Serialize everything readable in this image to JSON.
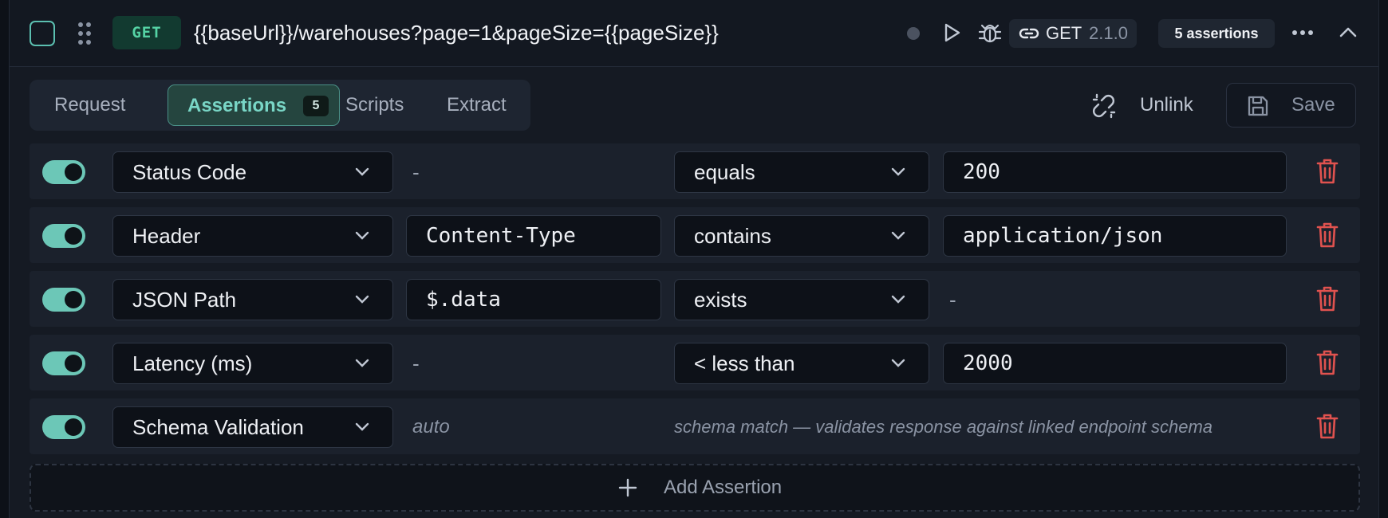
{
  "header": {
    "method": "GET",
    "url": "{{baseUrl}}/warehouses?page=1&pageSize={{pageSize}}",
    "version_method": "GET",
    "version": "2.1.0",
    "assertion_count": "5 assertions"
  },
  "tabs": [
    {
      "label": "Request"
    },
    {
      "label": "Assertions",
      "badge": "5"
    },
    {
      "label": "Scripts"
    },
    {
      "label": "Extract"
    }
  ],
  "actions": {
    "unlink": "Unlink",
    "save": "Save"
  },
  "rows": [
    {
      "type": "Status Code",
      "target": "-",
      "operator": "equals",
      "value": "200",
      "enabled": true
    },
    {
      "type": "Header",
      "target": "Content-Type",
      "operator": "contains",
      "value": "application/json",
      "enabled": true
    },
    {
      "type": "JSON Path",
      "target": "$.data",
      "operator": "exists",
      "value": "-",
      "enabled": true
    },
    {
      "type": "Latency (ms)",
      "target": "-",
      "operator": "< less than",
      "value": "2000",
      "enabled": true
    },
    {
      "type": "Schema Validation",
      "target": "auto",
      "description": "schema match — validates response against linked endpoint schema",
      "enabled": true
    }
  ],
  "add_label": "Add Assertion",
  "colors": {
    "accent": "#6cc7b7",
    "method_green": "#55d3a5",
    "danger": "#e0524f"
  }
}
